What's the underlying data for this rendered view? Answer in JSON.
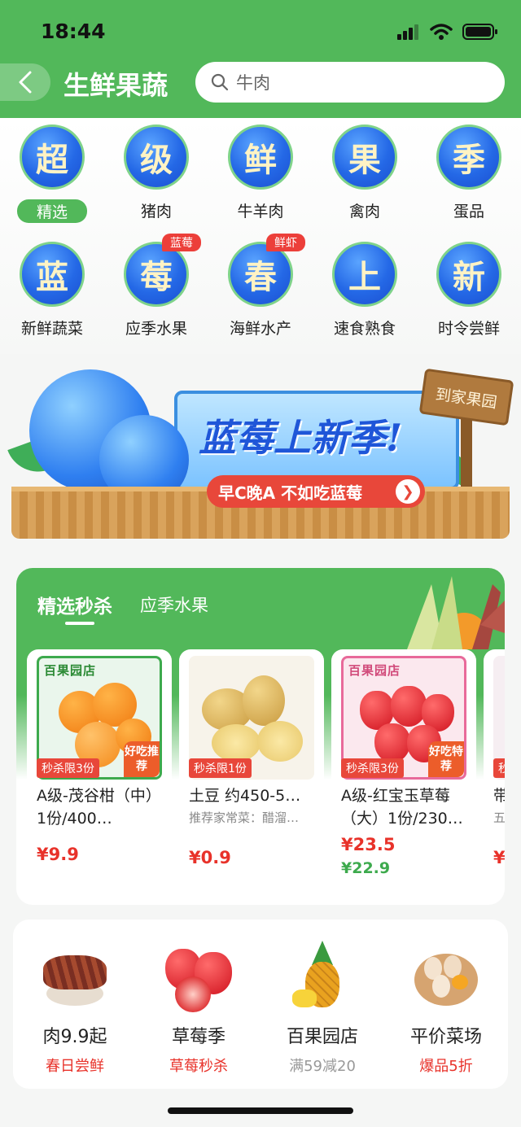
{
  "status": {
    "time": "18:44"
  },
  "header": {
    "title": "生鲜果蔬",
    "search_placeholder": "牛肉"
  },
  "categories": [
    {
      "glyph": "超",
      "label": "精选",
      "active": true
    },
    {
      "glyph": "级",
      "label": "猪肉"
    },
    {
      "glyph": "鲜",
      "label": "牛羊肉"
    },
    {
      "glyph": "果",
      "label": "禽肉"
    },
    {
      "glyph": "季",
      "label": "蛋品"
    },
    {
      "glyph": "蓝",
      "label": "新鲜蔬菜"
    },
    {
      "glyph": "莓",
      "label": "应季水果",
      "badge": "蓝莓"
    },
    {
      "glyph": "春",
      "label": "海鲜水产",
      "badge": "鲜虾"
    },
    {
      "glyph": "上",
      "label": "速食熟食"
    },
    {
      "glyph": "新",
      "label": "时令尝鲜"
    }
  ],
  "banner": {
    "title": "蓝莓上新季!",
    "subtitle": "早C晚A 不如吃蓝莓",
    "sign": "到家果园",
    "arrow": "❯"
  },
  "flash_sale": {
    "tabs": [
      "精选秒杀",
      "应季水果"
    ],
    "products": [
      {
        "store": "百果园店",
        "tag": "秒杀限3份",
        "stamp": "好吃推荐",
        "name": "A级-茂谷柑（中）1份/400…",
        "price": "¥9.9"
      },
      {
        "tag": "秒杀限1份",
        "name": "土豆 约450-5…",
        "desc": "推荐家常菜：醋溜…",
        "price": "¥0.9"
      },
      {
        "store": "百果园店",
        "tag": "秒杀限3份",
        "stamp": "好吃特荐",
        "name": "A级-红宝玉草莓（大）1份/230…",
        "price": "¥23.5",
        "member_price": "¥22.9"
      },
      {
        "tag": "秒",
        "name": "带",
        "desc": "五",
        "price": "¥"
      }
    ]
  },
  "quick_links": [
    {
      "title": "肉9.9起",
      "sub": "春日尝鲜",
      "sub_style": "red"
    },
    {
      "title": "草莓季",
      "sub": "草莓秒杀",
      "sub_style": "red"
    },
    {
      "title": "百果园店",
      "sub": "满59减20",
      "sub_style": "gray"
    },
    {
      "title": "平价菜场",
      "sub": "爆品5折",
      "sub_style": "red"
    }
  ],
  "colors": {
    "brand_green": "#52b85a",
    "price_red": "#e8322a",
    "badge_red": "#ec3f3a"
  }
}
